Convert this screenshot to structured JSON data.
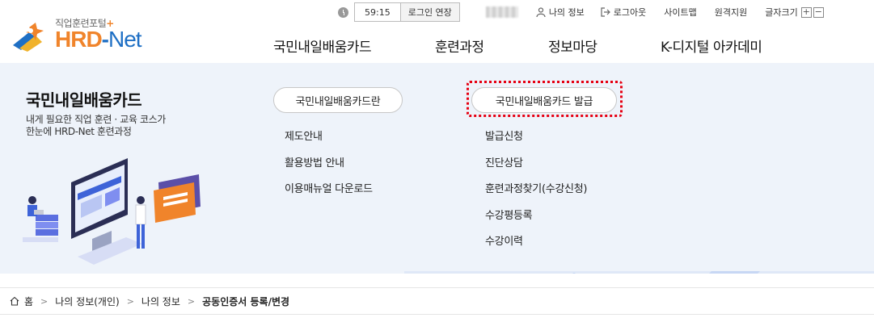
{
  "logo": {
    "tagline": "직업훈련포털",
    "tagline_plus": "+",
    "brand_hrd": "HRD",
    "brand_dash": "-",
    "brand_net": "Net"
  },
  "util": {
    "session_time": "59:15",
    "extend_label": "로그인 연장",
    "my_info": "나의 정보",
    "logout": "로그아웃",
    "sitemap": "사이트맵",
    "remote_support": "원격지원",
    "font_size": "글자크기",
    "font_plus": "+",
    "font_minus": "−"
  },
  "gnb": [
    "국민내일배움카드",
    "훈련과정",
    "정보마당",
    "K-디지털 아카데미"
  ],
  "panel": {
    "title": "국민내일배움카드",
    "desc_line1": "내게 필요한 직업 훈련 · 교육 코스가",
    "desc_line2": "한눈에 HRD-Net 훈련과정",
    "col1": {
      "head": "국민내일배움카드란",
      "items": [
        "제도안내",
        "활용방법 안내",
        "이용매뉴얼 다운로드"
      ]
    },
    "col2": {
      "head": "국민내일배움카드 발급",
      "items": [
        "발급신청",
        "진단상담",
        "훈련과정찾기(수강신청)",
        "수강평등록",
        "수강이력"
      ]
    }
  },
  "breadcrumb": [
    "홈",
    "나의 정보(개인)",
    "나의 정보",
    "공동인증서 등록/변경"
  ],
  "colors": {
    "accent_orange": "#f0842b",
    "brand_blue": "#1e6fc4",
    "panel_bg": "#eef3fa",
    "highlight_red": "#e60012"
  }
}
